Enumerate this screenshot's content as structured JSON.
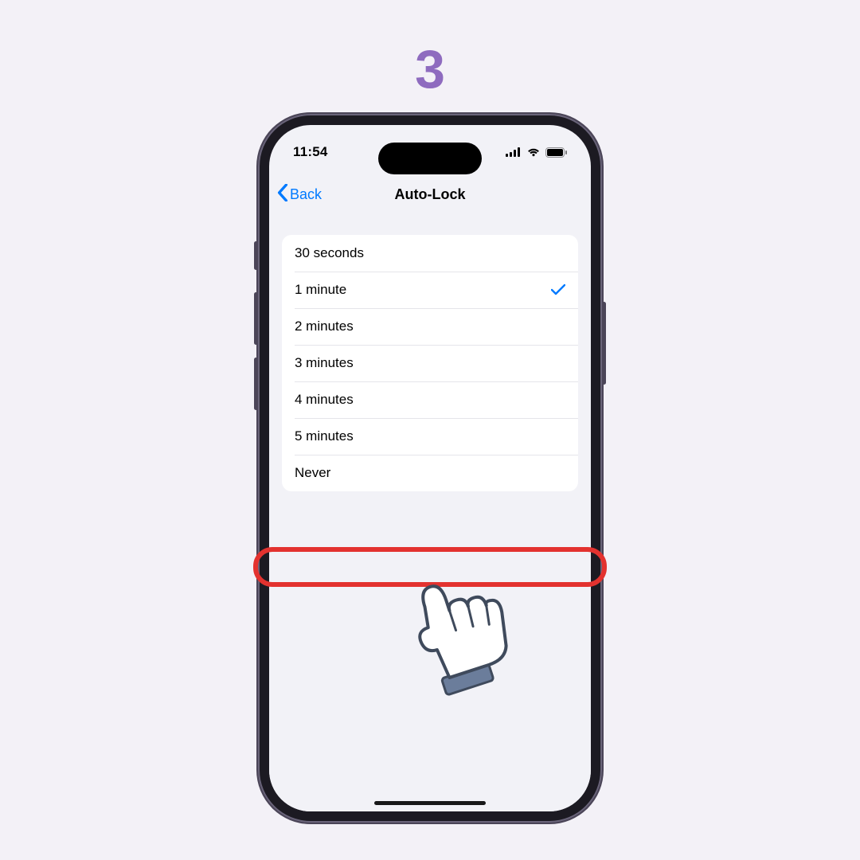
{
  "step_number": "3",
  "status": {
    "time": "11:54"
  },
  "nav": {
    "back_label": "Back",
    "title": "Auto-Lock"
  },
  "options": [
    {
      "label": "30 seconds",
      "selected": false,
      "highlighted": false
    },
    {
      "label": "1 minute",
      "selected": true,
      "highlighted": false
    },
    {
      "label": "2 minutes",
      "selected": false,
      "highlighted": false
    },
    {
      "label": "3 minutes",
      "selected": false,
      "highlighted": false
    },
    {
      "label": "4 minutes",
      "selected": false,
      "highlighted": false
    },
    {
      "label": "5 minutes",
      "selected": false,
      "highlighted": false
    },
    {
      "label": "Never",
      "selected": false,
      "highlighted": true
    }
  ],
  "colors": {
    "page_bg": "#f3f1f7",
    "step_number": "#8e6bbf",
    "ios_tint": "#007aff",
    "highlight_ring": "#e3322f"
  }
}
